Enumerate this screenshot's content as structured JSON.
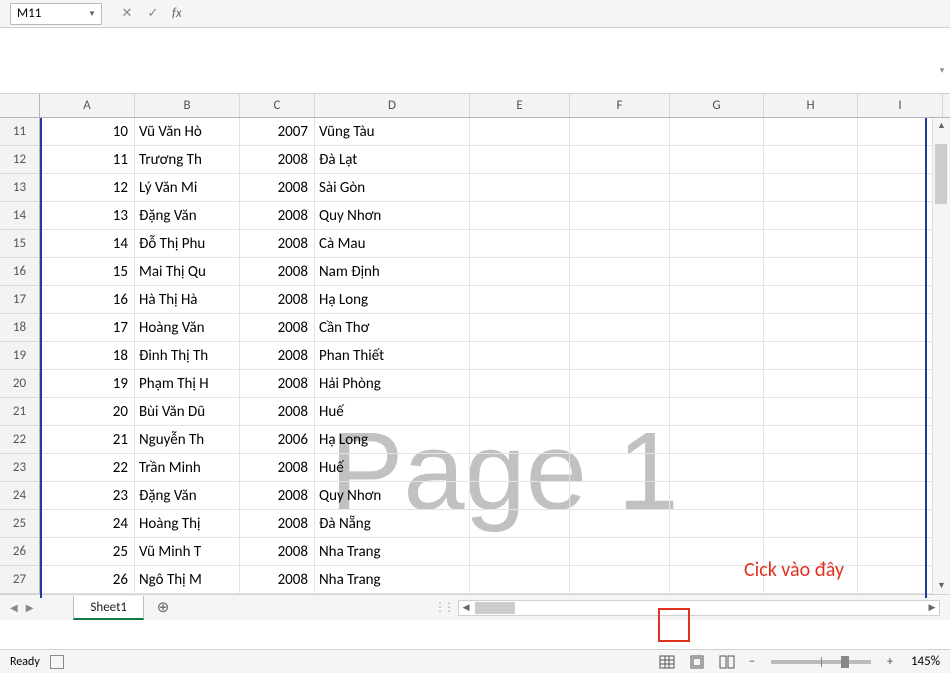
{
  "name_box": "M11",
  "fx_label": "fx",
  "columns": [
    "A",
    "B",
    "C",
    "D",
    "E",
    "F",
    "G",
    "H",
    "I"
  ],
  "rows": [
    {
      "n": 11,
      "a": 10,
      "b": "Vũ Văn Hò",
      "c": 2007,
      "d": "Vũng Tàu"
    },
    {
      "n": 12,
      "a": 11,
      "b": "Trương Th",
      "c": 2008,
      "d": "Đà Lạt"
    },
    {
      "n": 13,
      "a": 12,
      "b": "Lý Văn Mi",
      "c": 2008,
      "d": "Sài Gòn"
    },
    {
      "n": 14,
      "a": 13,
      "b": "Đặng Văn",
      "c": 2008,
      "d": "Quy Nhơn"
    },
    {
      "n": 15,
      "a": 14,
      "b": "Đỗ Thị Phu",
      "c": 2008,
      "d": "Cà Mau"
    },
    {
      "n": 16,
      "a": 15,
      "b": "Mai Thị Qu",
      "c": 2008,
      "d": "Nam Định"
    },
    {
      "n": 17,
      "a": 16,
      "b": "Hà Thị Hà",
      "c": 2008,
      "d": "Hạ Long"
    },
    {
      "n": 18,
      "a": 17,
      "b": "Hoàng Văn",
      "c": 2008,
      "d": "Cần Thơ"
    },
    {
      "n": 19,
      "a": 18,
      "b": "Đinh Thị Th",
      "c": 2008,
      "d": "Phan Thiết"
    },
    {
      "n": 20,
      "a": 19,
      "b": "Phạm Thị H",
      "c": 2008,
      "d": "Hải Phòng"
    },
    {
      "n": 21,
      "a": 20,
      "b": "Bùi Văn Dũ",
      "c": 2008,
      "d": "Huế"
    },
    {
      "n": 22,
      "a": 21,
      "b": "Nguyễn Th",
      "c": 2006,
      "d": "Hạ Long"
    },
    {
      "n": 23,
      "a": 22,
      "b": "Trần Minh",
      "c": 2008,
      "d": "Huế"
    },
    {
      "n": 24,
      "a": 23,
      "b": "Đặng Văn",
      "c": 2008,
      "d": "Quy Nhơn"
    },
    {
      "n": 25,
      "a": 24,
      "b": "Hoàng Thị",
      "c": 2008,
      "d": "Đà Nẵng"
    },
    {
      "n": 26,
      "a": 25,
      "b": "Vũ Minh T",
      "c": 2008,
      "d": "Nha Trang"
    },
    {
      "n": 27,
      "a": 26,
      "b": "Ngô Thị M",
      "c": 2008,
      "d": "Nha Trang"
    }
  ],
  "watermark": "Page 1",
  "annotation": "Cick vào đây",
  "sheet_tab": "Sheet1",
  "status_ready": "Ready",
  "zoom_label": "145%",
  "zoom_minus": "−",
  "zoom_plus": "+"
}
